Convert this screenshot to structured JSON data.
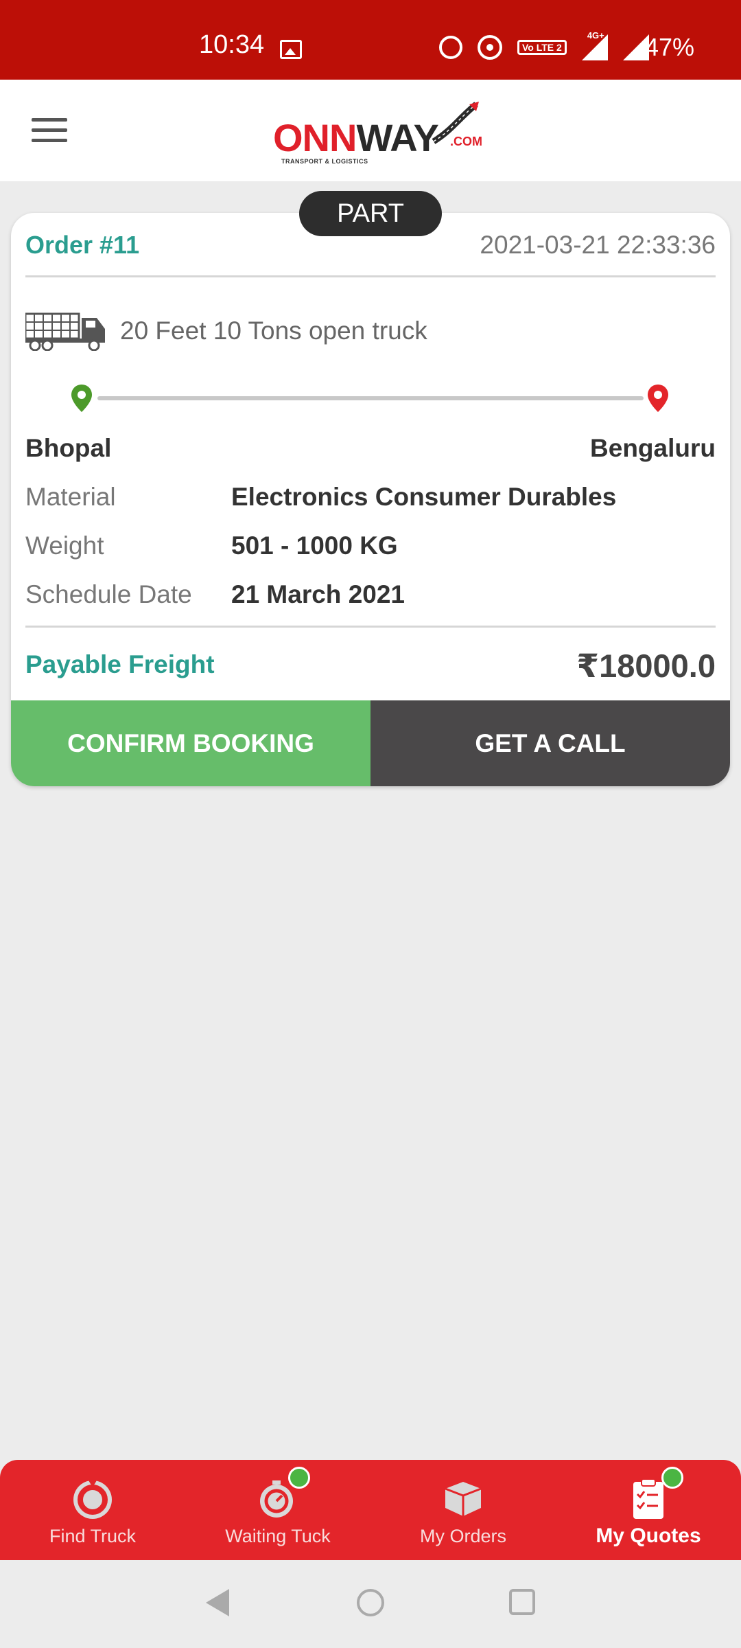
{
  "status_bar": {
    "time": "10:34",
    "battery": "47%",
    "network": "4G+",
    "volte": "Vo LTE 2",
    "icons": [
      "image-icon",
      "alarm-icon",
      "hotspot-icon",
      "volte-icon",
      "signal-icon",
      "signal-icon"
    ]
  },
  "header": {
    "logo_main_red": "ONN",
    "logo_main_dark": "WAY",
    "logo_com": ".COM",
    "logo_tag": "TRANSPORT & LOGISTICS",
    "menu_icon": "hamburger-icon"
  },
  "order": {
    "badge": "PART",
    "title": "Order #11",
    "datetime": "2021-03-21 22:33:36",
    "truck": "20 Feet 10 Tons open truck",
    "from_city": "Bhopal",
    "to_city": "Bengaluru",
    "details": [
      {
        "label": "Material",
        "value": "Electronics Consumer Durables"
      },
      {
        "label": "Weight",
        "value": "501 - 1000 KG"
      },
      {
        "label": "Schedule Date",
        "value": "21 March 2021"
      }
    ],
    "freight_label": "Payable Freight",
    "freight_value": "₹18000.0",
    "confirm_label": "CONFIRM BOOKING",
    "call_label": "GET A CALL"
  },
  "bottom_nav": {
    "items": [
      {
        "label": "Find Truck",
        "icon": "find-truck-icon",
        "active": false,
        "dot": false
      },
      {
        "label": "Waiting Tuck",
        "icon": "timer-icon",
        "active": false,
        "dot": true
      },
      {
        "label": "My Orders",
        "icon": "box-icon",
        "active": false,
        "dot": false
      },
      {
        "label": "My Quotes",
        "icon": "clipboard-icon",
        "active": true,
        "dot": true
      }
    ]
  },
  "colors": {
    "status_bar": "#bc0f07",
    "brand_red": "#e3252a",
    "teal": "#2a9d8f",
    "confirm_green": "#66bd6a",
    "call_dark": "#4a4849",
    "badge_dot_green": "#4bb543"
  }
}
